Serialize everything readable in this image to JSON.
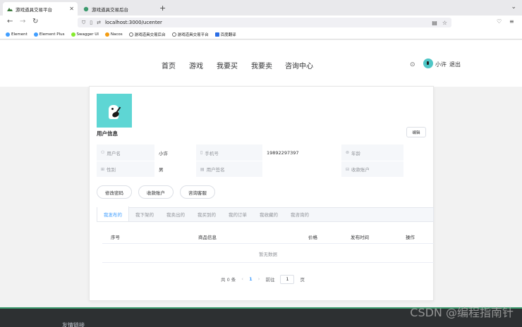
{
  "browser": {
    "tabs": [
      {
        "label": "游戏道具交易平台",
        "active": true
      },
      {
        "label": "游戏道具交易后台",
        "active": false
      }
    ],
    "url": "localhost:3000/ucenter",
    "bookmarks": [
      {
        "label": "Element",
        "color": "#409eff"
      },
      {
        "label": "Element Plus",
        "color": "#409eff"
      },
      {
        "label": "Swagger UI",
        "color": "#85ea2d"
      },
      {
        "label": "Nacos",
        "color": "#f39c12"
      },
      {
        "label": "游戏道具交易后台",
        "color": "#666666"
      },
      {
        "label": "游戏道具交易平台",
        "color": "#666666"
      },
      {
        "label": "百度翻译",
        "color": "#2b6de5"
      }
    ]
  },
  "header": {
    "nav": [
      "首页",
      "游戏",
      "我要买",
      "我要卖",
      "咨询中心"
    ],
    "username": "小许",
    "logout": "退出"
  },
  "profile": {
    "title": "用户信息",
    "edit": "编辑",
    "rows": [
      [
        {
          "label": "用户名",
          "value": "小许",
          "icon": "user-icon"
        },
        {
          "label": "手机号",
          "value": "19892297397",
          "icon": "phone-icon"
        },
        {
          "label": "年龄",
          "value": "",
          "icon": "location-icon"
        }
      ],
      [
        {
          "label": "性别",
          "value": "男",
          "icon": "gender-icon"
        },
        {
          "label": "用户签名",
          "value": "",
          "icon": "signature-icon"
        },
        {
          "label": "收款账户",
          "value": "",
          "icon": "account-icon"
        }
      ]
    ],
    "actions": [
      "修改密码",
      "收款账户",
      "咨询客服"
    ]
  },
  "orderTabs": [
    "我发布的",
    "我下架的",
    "我卖出的",
    "我买到的",
    "我的订单",
    "我收藏的",
    "我咨询的"
  ],
  "table": {
    "columns": [
      "序号",
      "商品信息",
      "价格",
      "发布时间",
      "操作"
    ],
    "empty": "暂无数据"
  },
  "pagination": {
    "total": "共 0 条",
    "page": "1",
    "goto": "前往",
    "goto_value": "1",
    "unit": "页"
  },
  "footer": {
    "text": "友情链接"
  },
  "watermark": "CSDN @编程指南针"
}
